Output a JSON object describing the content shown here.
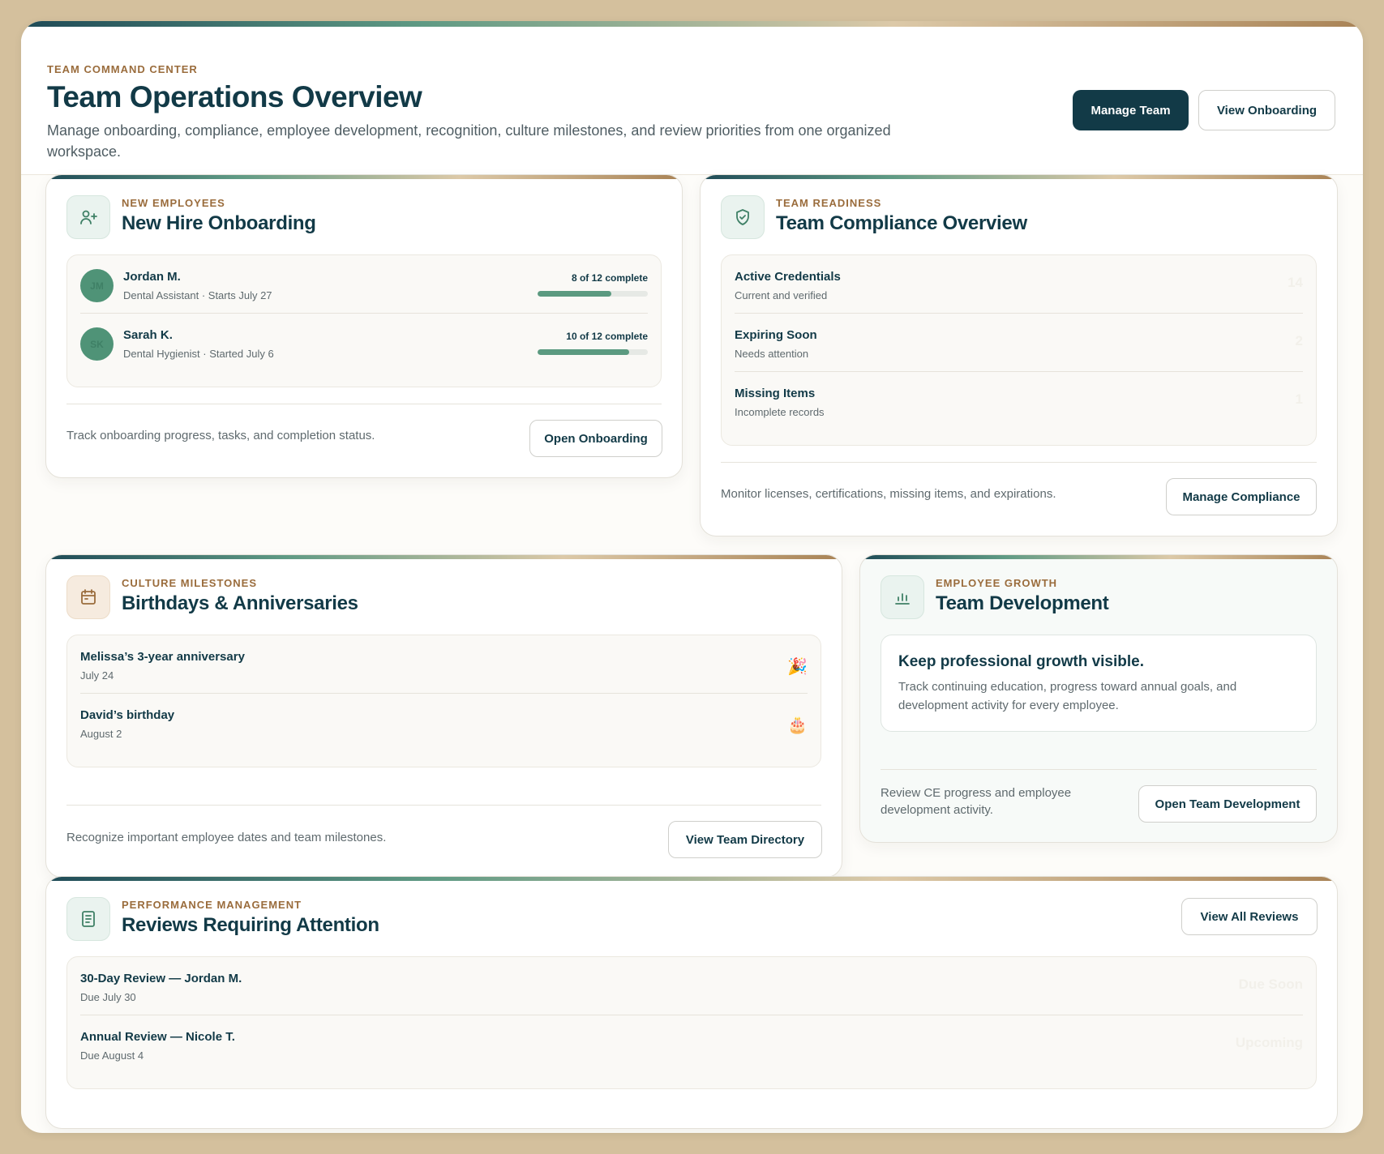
{
  "header": {
    "eyebrow": "TEAM COMMAND CENTER",
    "title": "Team Operations Overview",
    "description": "Manage onboarding, compliance, employee development, recognition, culture milestones, and review priorities from one organized workspace.",
    "manage_team_label": "Manage Team",
    "view_onboarding_label": "View Onboarding"
  },
  "onboarding": {
    "eyebrow": "NEW EMPLOYEES",
    "title": "New Hire Onboarding",
    "icon": "user-plus-icon",
    "hires": [
      {
        "initials": "JM",
        "name": "Jordan M.",
        "role": "Dental Assistant · Starts July 27",
        "progress_label": "8 of 12 complete",
        "progress": 0.667
      },
      {
        "initials": "SK",
        "name": "Sarah K.",
        "role": "Dental Hygienist · Started July 6",
        "progress_label": "10 of 12 complete",
        "progress": 0.833
      }
    ],
    "footer": "Track onboarding progress, tasks, and completion status.",
    "button": "Open Onboarding"
  },
  "compliance": {
    "eyebrow": "TEAM READINESS",
    "title": "Team Compliance Overview",
    "icon": "shield-check-icon",
    "items": [
      {
        "title": "Active Credentials",
        "sub": "Current and verified",
        "value": "14"
      },
      {
        "title": "Expiring Soon",
        "sub": "Needs attention",
        "value": "2"
      },
      {
        "title": "Missing Items",
        "sub": "Incomplete records",
        "value": "1"
      }
    ],
    "footer": "Monitor licenses, certifications, missing items, and expirations.",
    "button": "Manage Compliance"
  },
  "culture": {
    "eyebrow": "CULTURE MILESTONES",
    "title": "Birthdays & Anniversaries",
    "icon": "calendar-icon",
    "items": [
      {
        "title": "Melissa’s 3-year anniversary",
        "date": "July 24",
        "emoji": "🎉"
      },
      {
        "title": "David’s birthday",
        "date": "August 2",
        "emoji": "🎂"
      }
    ],
    "footer": "Recognize important employee dates and team milestones.",
    "button": "View Team Directory"
  },
  "development": {
    "eyebrow": "EMPLOYEE GROWTH",
    "title": "Team Development",
    "icon": "bar-chart-icon",
    "callout_title": "Keep professional growth visible.",
    "callout_text": "Track continuing education, progress toward annual goals, and development activity for every employee.",
    "footer": "Review CE progress and employee development activity.",
    "button": "Open Team Development"
  },
  "reviews": {
    "eyebrow": "PERFORMANCE MANAGEMENT",
    "title": "Reviews Requiring Attention",
    "icon": "document-icon",
    "button": "View All Reviews",
    "items": [
      {
        "title": "30-Day Review — Jordan M.",
        "due": "Due July 30",
        "status": "Due Soon"
      },
      {
        "title": "Annual Review — Nicole T.",
        "due": "Due August 4",
        "status": "Upcoming"
      }
    ]
  },
  "colors": {
    "primary": "#123a47",
    "accent_green": "#5b9a80",
    "eyebrow_brown": "#9a6c3c",
    "frame_tan": "#d4c09d"
  }
}
